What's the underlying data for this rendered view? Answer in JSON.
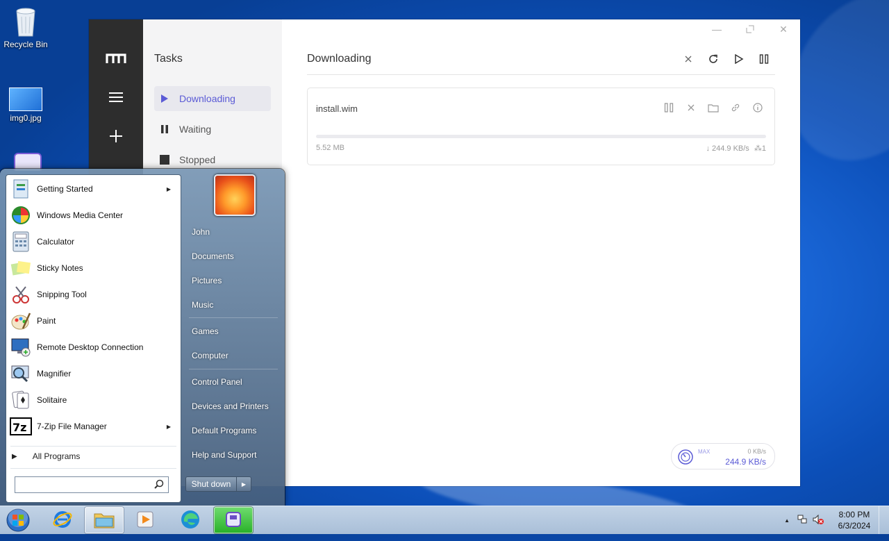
{
  "desktop": {
    "icons": [
      {
        "label": "Recycle Bin",
        "icon": "recycle-bin-icon"
      },
      {
        "label": "img0.jpg",
        "icon": "image-file-icon"
      }
    ]
  },
  "app": {
    "nav": {
      "title": "Tasks",
      "items": [
        {
          "label": "Downloading",
          "icon": "play-icon",
          "active": true
        },
        {
          "label": "Waiting",
          "icon": "pause-icon",
          "active": false
        },
        {
          "label": "Stopped",
          "icon": "stop-icon",
          "active": false
        }
      ]
    },
    "main": {
      "title": "Downloading",
      "task": {
        "name": "install.wim",
        "size": "5.52 MB",
        "speed": "↓ 244.9 KB/s",
        "connections": "1",
        "progress": 0.0
      }
    },
    "speed_widget": {
      "max_label": "MAX",
      "upload": "0 KB/s",
      "download": "244.9 KB/s"
    },
    "accent": "#5b5bd6"
  },
  "start_menu": {
    "programs": [
      {
        "label": "Getting Started",
        "icon": "getting-started-icon",
        "submenu": true
      },
      {
        "label": "Windows Media Center",
        "icon": "media-center-icon",
        "submenu": false
      },
      {
        "label": "Calculator",
        "icon": "calculator-icon",
        "submenu": false
      },
      {
        "label": "Sticky Notes",
        "icon": "sticky-notes-icon",
        "submenu": false
      },
      {
        "label": "Snipping Tool",
        "icon": "snipping-tool-icon",
        "submenu": false
      },
      {
        "label": "Paint",
        "icon": "paint-icon",
        "submenu": false
      },
      {
        "label": "Remote Desktop Connection",
        "icon": "remote-desktop-icon",
        "submenu": false
      },
      {
        "label": "Magnifier",
        "icon": "magnifier-icon",
        "submenu": false
      },
      {
        "label": "Solitaire",
        "icon": "solitaire-icon",
        "submenu": false
      },
      {
        "label": "7-Zip File Manager",
        "icon": "7zip-icon",
        "submenu": true
      }
    ],
    "all_programs": "All Programs",
    "search_value": "",
    "right_items": [
      "John",
      "Documents",
      "Pictures",
      "Music",
      "Games",
      "Computer",
      "Control Panel",
      "Devices and Printers",
      "Default Programs",
      "Help and Support"
    ],
    "shutdown": "Shut down"
  },
  "taskbar": {
    "apps": [
      "internet-explorer",
      "windows-explorer",
      "media-player",
      "edge",
      "motrix"
    ],
    "time": "8:00 PM",
    "date": "6/3/2024"
  }
}
